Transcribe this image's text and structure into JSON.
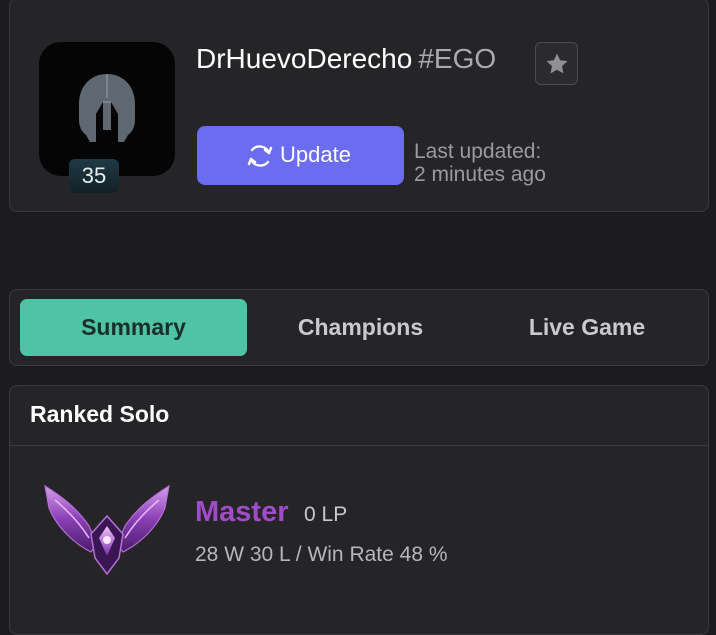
{
  "profile": {
    "name": "DrHuevoDerecho",
    "tag": "#EGO",
    "level": "35",
    "avatar_icon": "spartan-helmet-icon",
    "favorite_icon": "star-icon",
    "update_label": "Update",
    "update_icon": "refresh-icon",
    "last_updated_label": "Last updated:",
    "last_updated_value": "2 minutes ago"
  },
  "tabs": [
    {
      "label": "Summary",
      "active": true
    },
    {
      "label": "Champions",
      "active": false
    },
    {
      "label": "Live Game",
      "active": false
    }
  ],
  "ranked": {
    "title": "Ranked Solo",
    "tier": "Master",
    "lp": "0 LP",
    "stats": "28 W 30 L / Win Rate 48 %",
    "emblem_icon": "master-emblem-icon",
    "tier_color": "#a24bc9"
  },
  "colors": {
    "accent": "#6c6cf0",
    "tab_active": "#4fc3a6",
    "background": "#1c1c1f",
    "card": "#252528"
  }
}
